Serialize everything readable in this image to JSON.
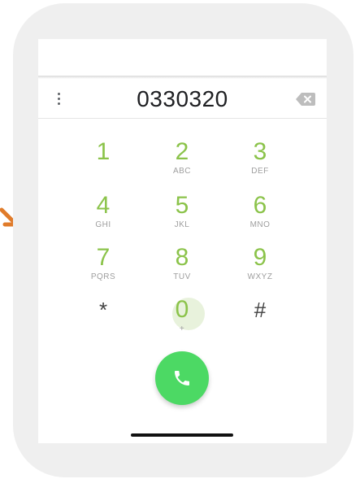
{
  "dialer": {
    "number": "0330320"
  },
  "keys": [
    {
      "digit": "1",
      "letters": ""
    },
    {
      "digit": "2",
      "letters": "ABC"
    },
    {
      "digit": "3",
      "letters": "DEF"
    },
    {
      "digit": "4",
      "letters": "GHI"
    },
    {
      "digit": "5",
      "letters": "JKL"
    },
    {
      "digit": "6",
      "letters": "MNO"
    },
    {
      "digit": "7",
      "letters": "PQRS"
    },
    {
      "digit": "8",
      "letters": "TUV"
    },
    {
      "digit": "9",
      "letters": "WXYZ"
    },
    {
      "digit": "*",
      "letters": ""
    },
    {
      "digit": "0",
      "letters": "+"
    },
    {
      "digit": "#",
      "letters": ""
    }
  ],
  "icons": {
    "menu": "more-vertical-icon",
    "backspace": "backspace-icon",
    "call": "phone-icon",
    "annotation": "arrow-icon"
  },
  "colors": {
    "digit": "#8bc34a",
    "call_button": "#4cd964",
    "arrow": "#e07b2a"
  }
}
